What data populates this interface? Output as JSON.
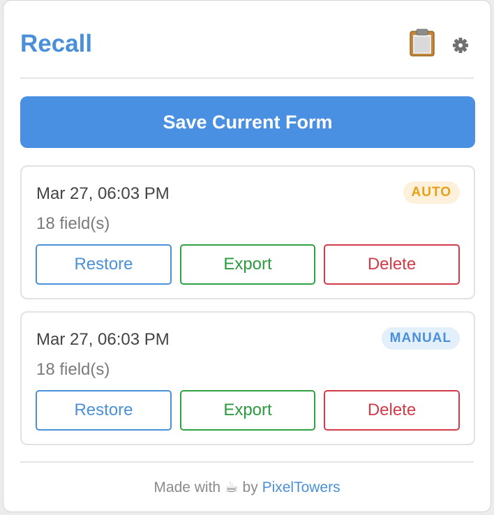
{
  "app": {
    "title": "Recall"
  },
  "header": {
    "clipboard_icon": "clipboard-icon",
    "settings_icon": "gear-icon"
  },
  "actions": {
    "save_label": "Save Current Form"
  },
  "snapshots": [
    {
      "date": "Mar 27, 06:03 PM",
      "fields": "18 field(s)",
      "badge": "AUTO",
      "restore_label": "Restore",
      "export_label": "Export",
      "delete_label": "Delete"
    },
    {
      "date": "Mar 27, 06:03 PM",
      "fields": "18 field(s)",
      "badge": "MANUAL",
      "restore_label": "Restore",
      "export_label": "Export",
      "delete_label": "Delete"
    }
  ],
  "footer": {
    "made_with": "Made with",
    "coffee": "☕",
    "by": "by",
    "link_label": "PixelTowers"
  },
  "colors": {
    "accent": "#4a90e2",
    "auto_badge": "#e6a019",
    "export": "#2a9a3e",
    "delete": "#d33a48"
  }
}
